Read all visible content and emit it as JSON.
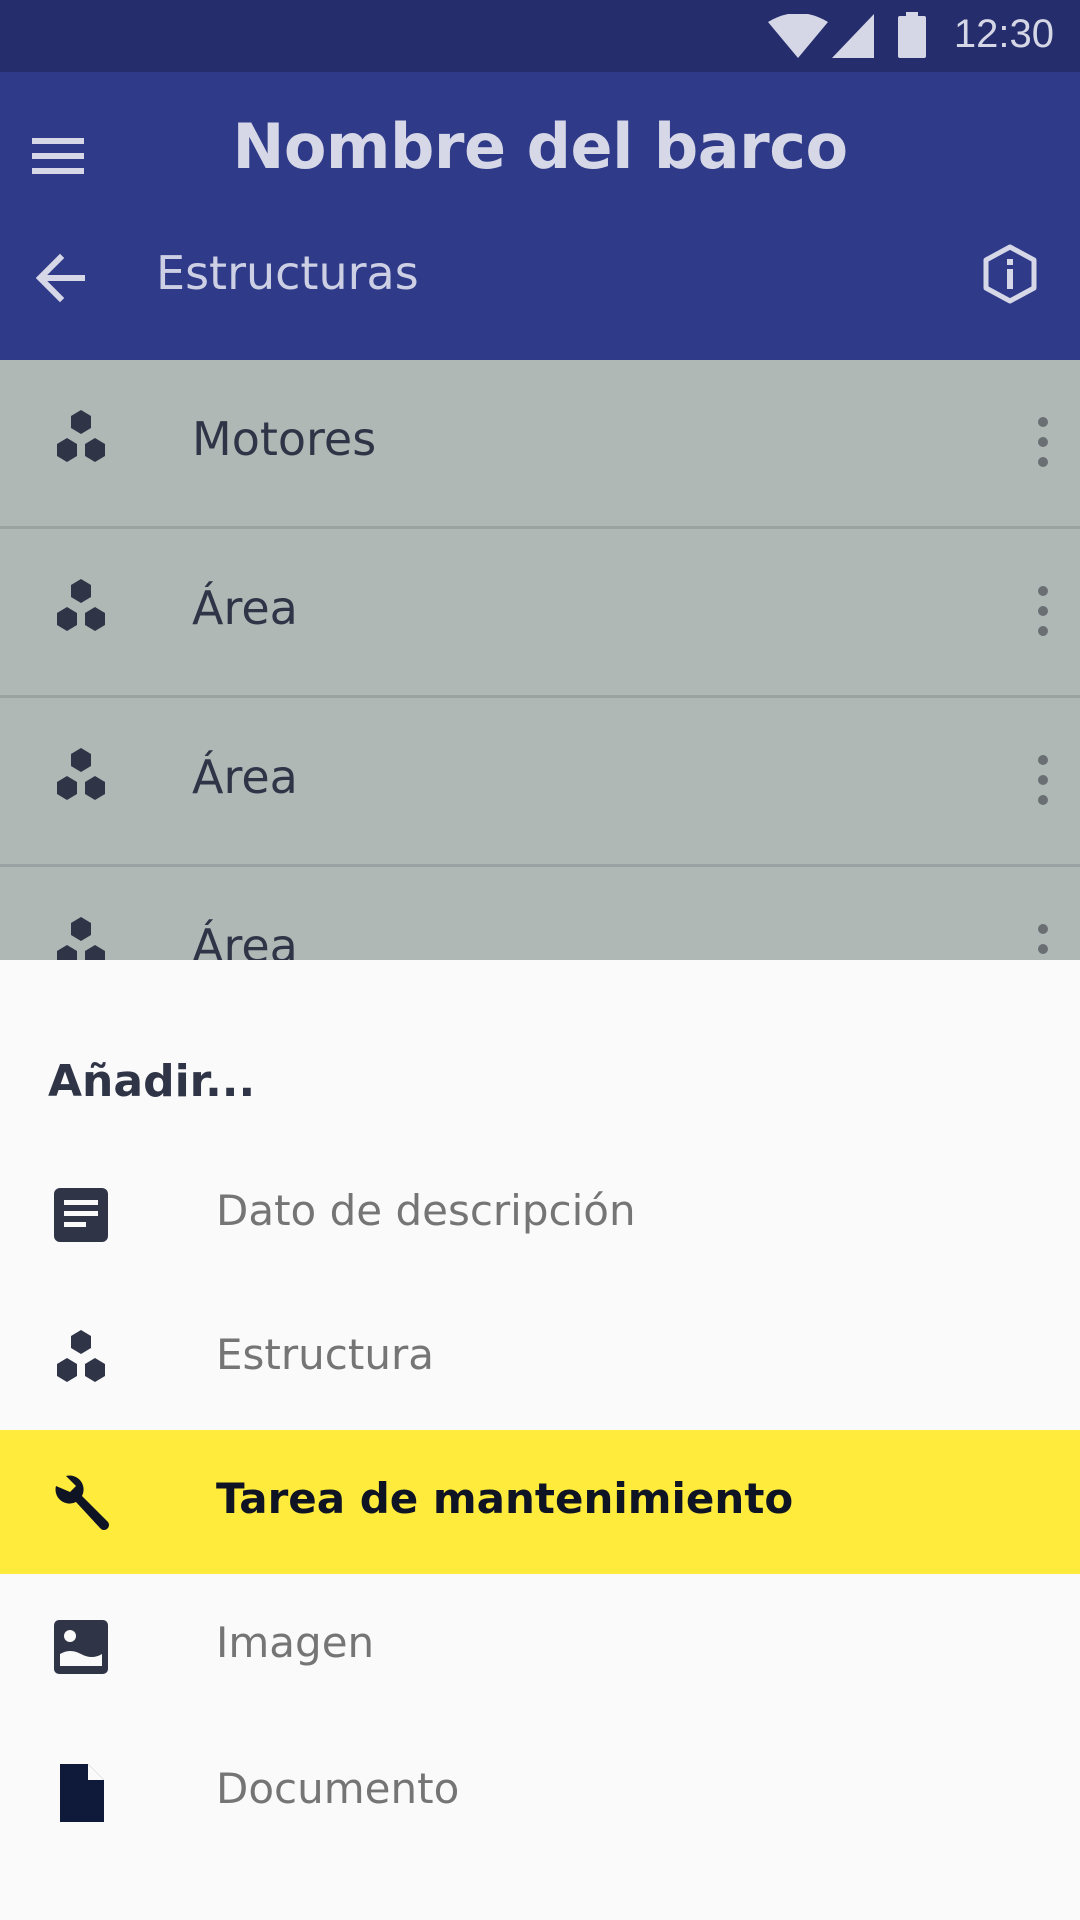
{
  "status_bar": {
    "time": "12:30",
    "icons": [
      "wifi-icon",
      "signal-icon",
      "battery-icon"
    ]
  },
  "app_bar": {
    "title": "Nombre del barco",
    "subtitle": "Estructuras",
    "icons": [
      "menu-icon",
      "back-arrow-icon",
      "info-icon"
    ],
    "color": "#2f3a88"
  },
  "list": {
    "items": [
      {
        "label": "Motores",
        "icon": "structure-icon"
      },
      {
        "label": "Área",
        "icon": "structure-icon"
      },
      {
        "label": "Área",
        "icon": "structure-icon"
      },
      {
        "label": "Área",
        "icon": "structure-icon"
      }
    ]
  },
  "sheet": {
    "heading": "Añadir...",
    "items": [
      {
        "label": "Dato de descripción",
        "icon": "description-icon",
        "selected": false
      },
      {
        "label": "Estructura",
        "icon": "structure-icon",
        "selected": false
      },
      {
        "label": "Tarea de mantenimiento",
        "icon": "wrench-icon",
        "selected": true
      },
      {
        "label": "Imagen",
        "icon": "image-icon",
        "selected": false
      },
      {
        "label": "Documento",
        "icon": "document-icon",
        "selected": false
      }
    ],
    "highlight_color": "#ffeb3b"
  }
}
